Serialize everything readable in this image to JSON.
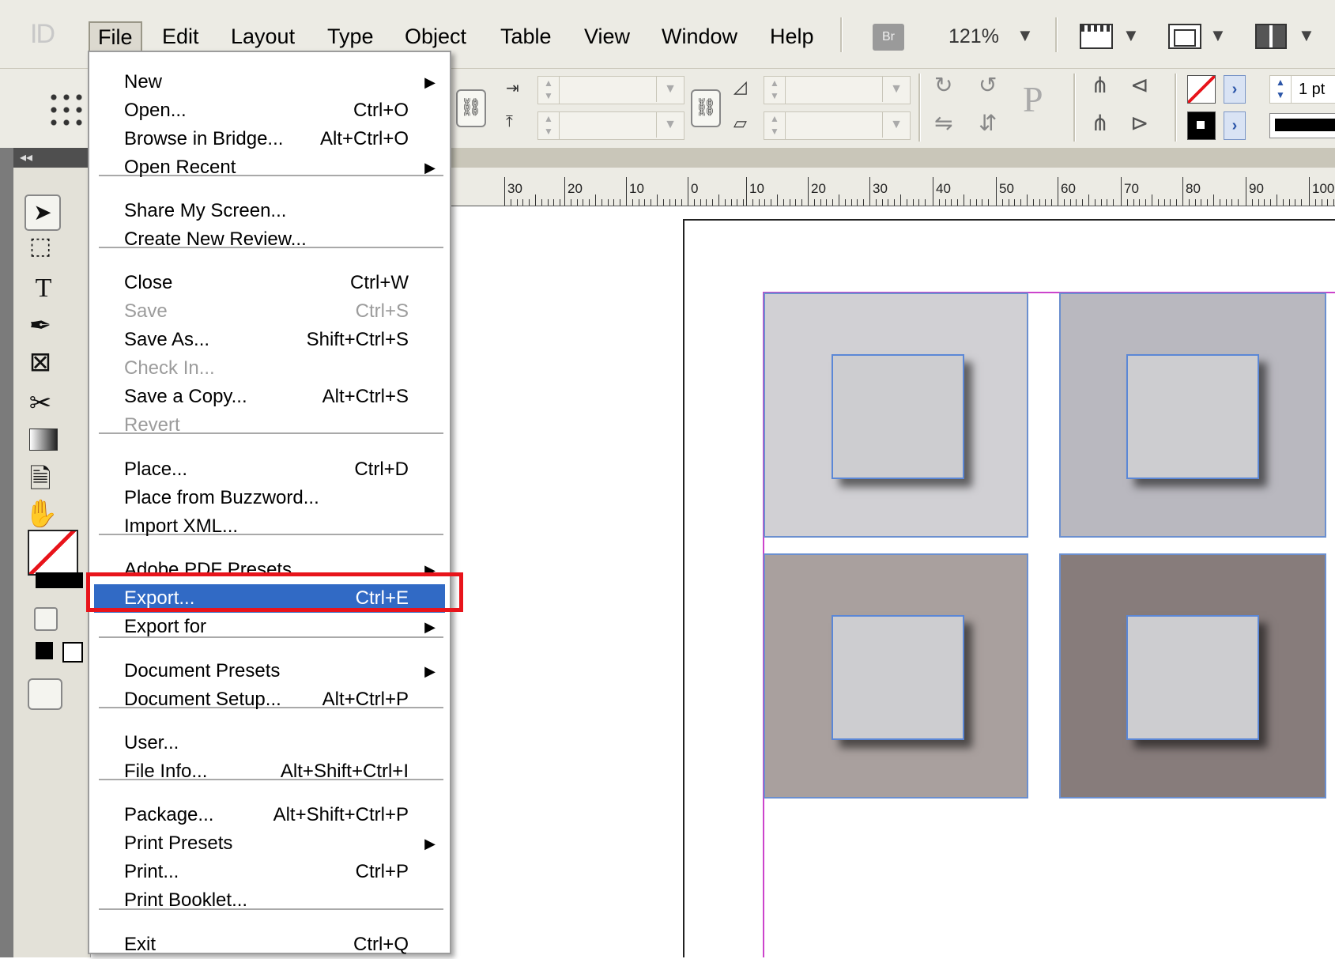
{
  "app": {
    "logo_text": "ID"
  },
  "menubar": {
    "items": [
      "File",
      "Edit",
      "Layout",
      "Type",
      "Object",
      "Table",
      "View",
      "Window",
      "Help"
    ],
    "bridge_label": "Br",
    "zoom": "121%"
  },
  "controlbar": {
    "stroke_weight": "1 pt",
    "proxy_letter": "P"
  },
  "ruler": {
    "labels": [
      "30",
      "20",
      "10",
      "0",
      "10",
      "20",
      "30",
      "40",
      "50",
      "60",
      "70",
      "80",
      "90",
      "100"
    ]
  },
  "file_menu": {
    "items": [
      {
        "label": "New",
        "shortcut": "",
        "submenu": true,
        "disabled": false
      },
      {
        "label": "Open...",
        "shortcut": "Ctrl+O",
        "submenu": false,
        "disabled": false
      },
      {
        "label": "Browse in Bridge...",
        "shortcut": "Alt+Ctrl+O",
        "submenu": false,
        "disabled": false
      },
      {
        "label": "Open Recent",
        "shortcut": "",
        "submenu": true,
        "disabled": false
      },
      {
        "label": "Share My Screen...",
        "shortcut": "",
        "submenu": false,
        "disabled": false
      },
      {
        "label": "Create New Review...",
        "shortcut": "",
        "submenu": false,
        "disabled": false
      },
      {
        "label": "Close",
        "shortcut": "Ctrl+W",
        "submenu": false,
        "disabled": false
      },
      {
        "label": "Save",
        "shortcut": "Ctrl+S",
        "submenu": false,
        "disabled": true
      },
      {
        "label": "Save As...",
        "shortcut": "Shift+Ctrl+S",
        "submenu": false,
        "disabled": false
      },
      {
        "label": "Check In...",
        "shortcut": "",
        "submenu": false,
        "disabled": true
      },
      {
        "label": "Save a Copy...",
        "shortcut": "Alt+Ctrl+S",
        "submenu": false,
        "disabled": false
      },
      {
        "label": "Revert",
        "shortcut": "",
        "submenu": false,
        "disabled": true
      },
      {
        "label": "Place...",
        "shortcut": "Ctrl+D",
        "submenu": false,
        "disabled": false
      },
      {
        "label": "Place from Buzzword...",
        "shortcut": "",
        "submenu": false,
        "disabled": false
      },
      {
        "label": "Import XML...",
        "shortcut": "",
        "submenu": false,
        "disabled": false
      },
      {
        "label": "Adobe PDF Presets",
        "shortcut": "",
        "submenu": true,
        "disabled": false
      },
      {
        "label": "Export...",
        "shortcut": "Ctrl+E",
        "submenu": false,
        "disabled": false,
        "highlighted": true
      },
      {
        "label": "Export for",
        "shortcut": "",
        "submenu": true,
        "disabled": false
      },
      {
        "label": "Document Presets",
        "shortcut": "",
        "submenu": true,
        "disabled": false
      },
      {
        "label": "Document Setup...",
        "shortcut": "Alt+Ctrl+P",
        "submenu": false,
        "disabled": false
      },
      {
        "label": "User...",
        "shortcut": "",
        "submenu": false,
        "disabled": false
      },
      {
        "label": "File Info...",
        "shortcut": "Alt+Shift+Ctrl+I",
        "submenu": false,
        "disabled": false
      },
      {
        "label": "Package...",
        "shortcut": "Alt+Shift+Ctrl+P",
        "submenu": false,
        "disabled": false
      },
      {
        "label": "Print Presets",
        "shortcut": "",
        "submenu": true,
        "disabled": false
      },
      {
        "label": "Print...",
        "shortcut": "Ctrl+P",
        "submenu": false,
        "disabled": false
      },
      {
        "label": "Print Booklet...",
        "shortcut": "",
        "submenu": false,
        "disabled": false
      },
      {
        "label": "Exit",
        "shortcut": "Ctrl+Q",
        "submenu": false,
        "disabled": false
      }
    ]
  },
  "colors": {
    "menu_highlight": "#316ac5",
    "callout_frame": "#e8141b",
    "tile_colors": [
      "#d1d0d4",
      "#b9b8bf",
      "#a9a09e",
      "#877c7b"
    ],
    "inner_box": "#cdcdd0"
  },
  "icons": {
    "submenu_arrow": "triangle-right-icon",
    "zoom_dropdown": "chevron-down-icon"
  }
}
